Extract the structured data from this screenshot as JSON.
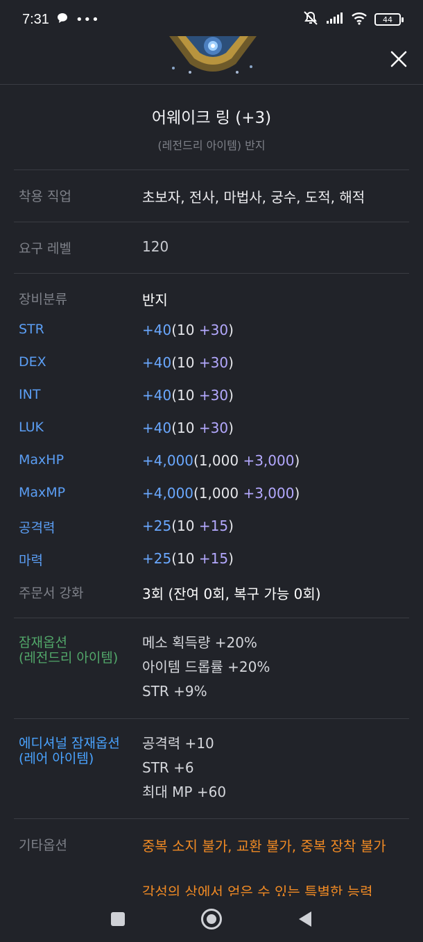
{
  "status": {
    "time": "7:31",
    "battery": "44"
  },
  "header": {
    "close_icon": "close-icon",
    "item_image": "ring-item-image"
  },
  "item": {
    "name": "어웨이크 링 (+3)",
    "subtitle": "(레전드리 아이템) 반지"
  },
  "info": {
    "job_label": "착용 직업",
    "job_value": "초보자, 전사, 마법사, 궁수, 도적, 해적",
    "level_label": "요구 레벨",
    "level_value": "120",
    "category_label": "장비분류",
    "category_value": "반지"
  },
  "stats": [
    {
      "label": "STR",
      "total": "+40",
      "base": "10",
      "bonus": "+30"
    },
    {
      "label": "DEX",
      "total": "+40",
      "base": "10",
      "bonus": "+30"
    },
    {
      "label": "INT",
      "total": "+40",
      "base": "10",
      "bonus": "+30"
    },
    {
      "label": "LUK",
      "total": "+40",
      "base": "10",
      "bonus": "+30"
    },
    {
      "label": "MaxHP",
      "total": "+4,000",
      "base": "1,000",
      "bonus": "+3,000"
    },
    {
      "label": "MaxMP",
      "total": "+4,000",
      "base": "1,000",
      "bonus": "+3,000"
    },
    {
      "label": "공격력",
      "total": "+25",
      "base": "10",
      "bonus": "+15"
    },
    {
      "label": "마력",
      "total": "+25",
      "base": "10",
      "bonus": "+15"
    }
  ],
  "scroll": {
    "label": "주문서 강화",
    "value": "3회 (잔여 0회, 복구 가능 0회)"
  },
  "potential": {
    "label_1": "잠재옵션",
    "label_2": "(레전드리 아이템)",
    "lines": [
      "메소 획득량 +20%",
      "아이템 드롭률 +20%",
      "STR +9%"
    ]
  },
  "additional": {
    "label_1": "에디셔널 잠재옵션",
    "label_2": "(레어 아이템)",
    "lines": [
      "공격력 +10",
      "STR +6",
      "최대 MP +60"
    ]
  },
  "other": {
    "label": "기타옵션",
    "value": "중복 소지 불가, 교환 불가, 중복 장착 불가",
    "next_line": "각성의 상에서 얻은 수 있는 특별한 능력"
  },
  "colors": {
    "background": "#212329",
    "total_stat": "#6aa8ff",
    "bonus_stat": "#b4a9ff",
    "potential_label": "#52a86a",
    "additional_label": "#4aa3ff",
    "other_value": "#f08a24"
  },
  "nav": {
    "recents_icon": "square-icon",
    "home_icon": "circle-home-icon",
    "back_icon": "triangle-back-icon"
  }
}
